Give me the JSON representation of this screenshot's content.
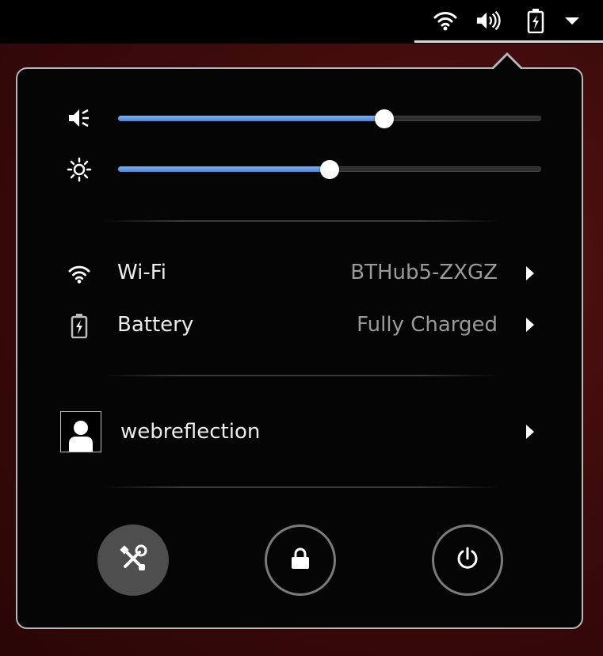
{
  "topbar": {
    "icons": [
      "wifi-icon",
      "volume-icon",
      "battery-charging-icon",
      "system-menu-arrow-icon"
    ]
  },
  "sliders": {
    "volume": {
      "icon": "volume-low-icon",
      "level_percent": 63
    },
    "brightness": {
      "icon": "brightness-icon",
      "level_percent": 50
    }
  },
  "menu": {
    "wifi": {
      "icon": "wifi-icon",
      "label": "Wi-Fi",
      "status": "BTHub5-ZXGZ"
    },
    "battery": {
      "icon": "battery-charging-icon",
      "label": "Battery",
      "status": "Fully Charged"
    },
    "user": {
      "icon": "avatar-icon",
      "label": "webreflection"
    }
  },
  "actions": {
    "settings": {
      "icon": "settings-tools-icon"
    },
    "lock": {
      "icon": "lock-icon"
    },
    "power": {
      "icon": "power-icon"
    }
  },
  "colors": {
    "slider_fill": "#4a86d6",
    "panel_bg": "#050505",
    "panel_border": "#b8b8b8",
    "desktop_bg": "#3a0a0a"
  }
}
